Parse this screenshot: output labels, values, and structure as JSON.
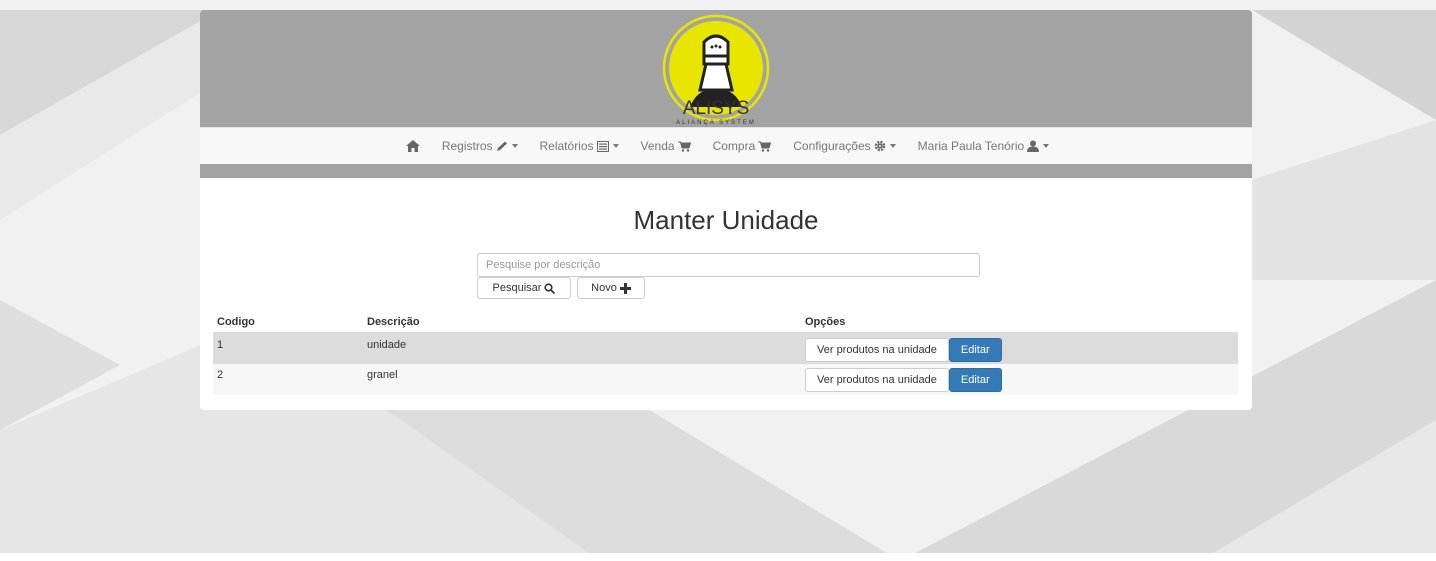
{
  "brand": {
    "name": "ALISYS",
    "tagline": "ALIANÇA SYSTEM"
  },
  "nav": {
    "items": [
      {
        "label": "",
        "icon": "home-icon"
      },
      {
        "label": "Registros",
        "icon": "pencil-icon",
        "dropdown": true
      },
      {
        "label": "Relatórios",
        "icon": "list-icon",
        "dropdown": true
      },
      {
        "label": "Venda",
        "icon": "cart-icon"
      },
      {
        "label": "Compra",
        "icon": "cart-icon"
      },
      {
        "label": "Configurações",
        "icon": "gear-icon",
        "dropdown": true
      },
      {
        "label": "Maria Paula Tenório",
        "icon": "user-icon",
        "dropdown": true
      }
    ]
  },
  "page": {
    "title": "Manter Unidade"
  },
  "search": {
    "placeholder": "Pesquise por descrição",
    "value": "",
    "search_label": "Pesquisar",
    "new_label": "Novo"
  },
  "table": {
    "headers": [
      "Codigo",
      "Descrição",
      "Opções"
    ],
    "rows": [
      {
        "code": "1",
        "description": "unidade"
      },
      {
        "code": "2",
        "description": "granel"
      }
    ],
    "view_label": "Ver produtos na unidade",
    "edit_label": "Editar"
  },
  "colors": {
    "header_bg": "#a3a3a3",
    "logo_yellow": "#e8e600",
    "primary": "#337ab7"
  }
}
